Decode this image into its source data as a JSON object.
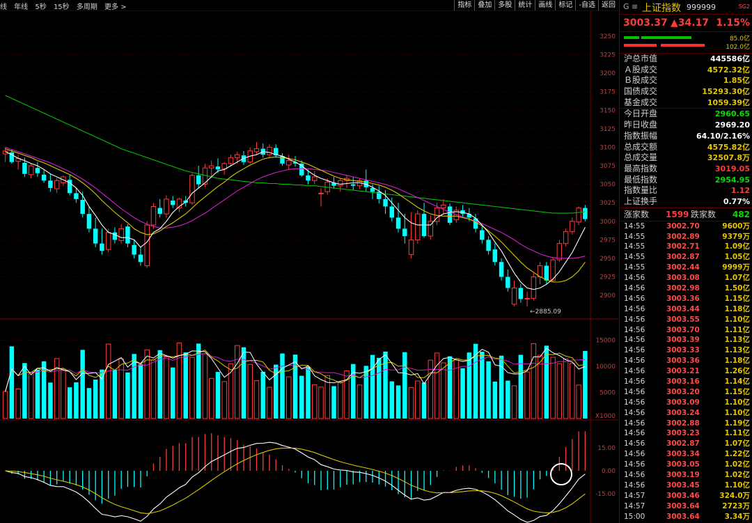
{
  "toolbar": {
    "periods": [
      "线",
      "年线",
      "5秒",
      "15秒",
      "多周期",
      "更多 >"
    ],
    "buttons": [
      "指标",
      "叠加",
      "多股",
      "统计",
      "画线",
      "标记",
      "-自选",
      "返回"
    ]
  },
  "instrument": {
    "g_label": "G ≡",
    "name": "上证指数",
    "code": "999999",
    "tag": "SG2",
    "price": "3003.37",
    "change": "▲34.17",
    "change_pct": "1.15%"
  },
  "flow": {
    "inflow": "85.0亿",
    "outflow": "102.0亿",
    "inflow_color": "#00c000",
    "outflow_color": "#ff3030"
  },
  "stats1": [
    {
      "k": "沪总市值",
      "v": "445586亿",
      "c": "#ffffff"
    },
    {
      "k": "Ａ股成交",
      "v": "4572.32亿",
      "c": "#e6c800"
    },
    {
      "k": "Ｂ股成交",
      "v": "1.85亿",
      "c": "#e6c800"
    },
    {
      "k": "国债成交",
      "v": "15293.30亿",
      "c": "#e6c800"
    },
    {
      "k": "基金成交",
      "v": "1059.39亿",
      "c": "#e6c800"
    }
  ],
  "stats2": [
    {
      "k": "今日开盘",
      "v": "2960.65",
      "c": "#00e000"
    },
    {
      "k": "昨日收盘",
      "v": "2969.20",
      "c": "#ffffff"
    },
    {
      "k": "指数振幅",
      "v": "64.10/2.16%",
      "c": "#ffffff"
    },
    {
      "k": "总成交额",
      "v": "4575.82亿",
      "c": "#e6c800"
    },
    {
      "k": "总成交量",
      "v": "32507.8万",
      "c": "#e6c800"
    },
    {
      "k": "最高指数",
      "v": "3019.05",
      "c": "#ff3b3b"
    },
    {
      "k": "最低指数",
      "v": "2954.95",
      "c": "#00e000"
    },
    {
      "k": "指数量比",
      "v": "1.12",
      "c": "#ff3b3b"
    },
    {
      "k": "上证换手",
      "v": "0.77%",
      "c": "#ffffff"
    }
  ],
  "breadth": {
    "up_label": "涨家数",
    "up": "1599",
    "down_label": "跌家数",
    "down": "482"
  },
  "ticks": [
    [
      "14:55",
      "3002.70",
      "9600万"
    ],
    [
      "14:55",
      "3002.89",
      "9379万"
    ],
    [
      "14:55",
      "3002.71",
      "1.09亿"
    ],
    [
      "14:55",
      "3002.87",
      "1.05亿"
    ],
    [
      "14:55",
      "3002.44",
      "9999万"
    ],
    [
      "14:56",
      "3003.08",
      "1.07亿"
    ],
    [
      "14:56",
      "3002.98",
      "1.50亿"
    ],
    [
      "14:56",
      "3003.36",
      "1.15亿"
    ],
    [
      "14:56",
      "3003.44",
      "1.18亿"
    ],
    [
      "14:56",
      "3003.55",
      "1.10亿"
    ],
    [
      "14:56",
      "3003.70",
      "1.11亿"
    ],
    [
      "14:56",
      "3003.39",
      "1.13亿"
    ],
    [
      "14:56",
      "3003.33",
      "1.13亿"
    ],
    [
      "14:56",
      "3003.36",
      "1.18亿"
    ],
    [
      "14:56",
      "3003.21",
      "1.26亿"
    ],
    [
      "14:56",
      "3003.16",
      "1.14亿"
    ],
    [
      "14:56",
      "3003.20",
      "1.15亿"
    ],
    [
      "14:56",
      "3003.09",
      "1.10亿"
    ],
    [
      "14:56",
      "3003.24",
      "1.10亿"
    ],
    [
      "14:56",
      "3002.88",
      "1.19亿"
    ],
    [
      "14:56",
      "3003.23",
      "1.11亿"
    ],
    [
      "14:56",
      "3002.87",
      "1.07亿"
    ],
    [
      "14:56",
      "3003.34",
      "1.22亿"
    ],
    [
      "14:56",
      "3003.05",
      "1.02亿"
    ],
    [
      "14:56",
      "3003.19",
      "1.02亿"
    ],
    [
      "14:56",
      "3003.45",
      "1.10亿"
    ],
    [
      "14:57",
      "3003.46",
      "324.0万"
    ],
    [
      "14:57",
      "3003.64",
      "2723万"
    ],
    [
      "15:00",
      "3003.64",
      "3.34万"
    ]
  ],
  "chart_data": {
    "type": "candlestick",
    "ylim": [
      2870,
      3265
    ],
    "price_ticks": [
      "3250",
      "3225",
      "3200",
      "3175",
      "3150",
      "3125",
      "3100",
      "3075",
      "3050",
      "3025",
      "3000",
      "2975",
      "2950",
      "2925",
      "2900"
    ],
    "low_label": "2885.09",
    "volume_ticks": [
      "15000",
      "10000",
      "5000"
    ],
    "volume_unit": "X1000",
    "macd_ticks": [
      "15.00",
      "0.00",
      "-15.00"
    ],
    "candles": [
      [
        3091,
        3100,
        3080,
        3095
      ],
      [
        3093,
        3097,
        3078,
        3080
      ],
      [
        3081,
        3090,
        3070,
        3085
      ],
      [
        3079,
        3086,
        3060,
        3064
      ],
      [
        3063,
        3078,
        3058,
        3075
      ],
      [
        3072,
        3080,
        3060,
        3065
      ],
      [
        3063,
        3070,
        3052,
        3055
      ],
      [
        3055,
        3064,
        3040,
        3045
      ],
      [
        3044,
        3058,
        3038,
        3055
      ],
      [
        3052,
        3062,
        3048,
        3060
      ],
      [
        3056,
        3063,
        3035,
        3038
      ],
      [
        3038,
        3045,
        3025,
        3030
      ],
      [
        3029,
        3040,
        3005,
        3010
      ],
      [
        3010,
        3020,
        2985,
        2990
      ],
      [
        2990,
        3005,
        2965,
        2970
      ],
      [
        2970,
        2990,
        2955,
        2960
      ],
      [
        2962,
        2990,
        2958,
        2985
      ],
      [
        2985,
        2992,
        2970,
        2975
      ],
      [
        2974,
        2996,
        2970,
        2990
      ],
      [
        2993,
        2996,
        2965,
        2970
      ],
      [
        2968,
        2975,
        2950,
        2955
      ],
      [
        2955,
        2965,
        2940,
        2945
      ],
      [
        2940,
        3000,
        2937,
        2995
      ],
      [
        2995,
        3025,
        2990,
        3020
      ],
      [
        3018,
        3030,
        3005,
        3010
      ],
      [
        3010,
        3035,
        3005,
        3030
      ],
      [
        3028,
        3034,
        3018,
        3022
      ],
      [
        3018,
        3032,
        3012,
        3030
      ],
      [
        3028,
        3034,
        3020,
        3025
      ],
      [
        3025,
        3065,
        3022,
        3062
      ],
      [
        3062,
        3075,
        3045,
        3050
      ],
      [
        3050,
        3078,
        3046,
        3072
      ],
      [
        3072,
        3082,
        3060,
        3075
      ],
      [
        3074,
        3085,
        3065,
        3070
      ],
      [
        3071,
        3080,
        3063,
        3078
      ],
      [
        3078,
        3090,
        3074,
        3086
      ],
      [
        3086,
        3094,
        3078,
        3090
      ],
      [
        3089,
        3095,
        3076,
        3080
      ],
      [
        3080,
        3100,
        3078,
        3095
      ],
      [
        3094,
        3107,
        3090,
        3098
      ],
      [
        3098,
        3105,
        3086,
        3090
      ],
      [
        3090,
        3104,
        3086,
        3100
      ],
      [
        3099,
        3104,
        3086,
        3089
      ],
      [
        3088,
        3092,
        3075,
        3078
      ],
      [
        3076,
        3090,
        3070,
        3082
      ],
      [
        3080,
        3088,
        3074,
        3078
      ],
      [
        3078,
        3082,
        3060,
        3062
      ],
      [
        3062,
        3070,
        3050,
        3055
      ],
      [
        3055,
        3068,
        3050,
        3060
      ],
      [
        3038,
        3045,
        3020,
        3038
      ],
      [
        3040,
        3058,
        3036,
        3053
      ],
      [
        3052,
        3060,
        3044,
        3048
      ],
      [
        3048,
        3058,
        3040,
        3055
      ],
      [
        3055,
        3062,
        3045,
        3058
      ],
      [
        3050,
        3060,
        3042,
        3048
      ],
      [
        3048,
        3058,
        3044,
        3055
      ],
      [
        3055,
        3070,
        3040,
        3046
      ],
      [
        3045,
        3050,
        3030,
        3040
      ],
      [
        3040,
        3048,
        3024,
        3030
      ],
      [
        3030,
        3042,
        3010,
        3020
      ],
      [
        3020,
        3032,
        3000,
        3005
      ],
      [
        3005,
        3025,
        2985,
        2990
      ],
      [
        2990,
        3010,
        2970,
        2980
      ],
      [
        2955,
        3012,
        2950,
        2975
      ],
      [
        2975,
        3015,
        2970,
        3010
      ],
      [
        3010,
        3025,
        2978,
        2980
      ],
      [
        2980,
        3008,
        2975,
        3000
      ],
      [
        3000,
        3025,
        2995,
        3018
      ],
      [
        3018,
        3030,
        3010,
        3022
      ],
      [
        3020,
        3024,
        2995,
        2998
      ],
      [
        3002,
        3020,
        2998,
        3015
      ],
      [
        3015,
        3022,
        3006,
        3010
      ],
      [
        3010,
        3018,
        3000,
        3005
      ],
      [
        3004,
        3010,
        2985,
        2990
      ],
      [
        2988,
        2995,
        2970,
        2975
      ],
      [
        2975,
        2980,
        2955,
        2960
      ],
      [
        2962,
        2970,
        2940,
        2945
      ],
      [
        2945,
        2950,
        2920,
        2925
      ],
      [
        2925,
        2935,
        2905,
        2910
      ],
      [
        2888,
        2920,
        2885,
        2910
      ],
      [
        2910,
        2915,
        2890,
        2895
      ],
      [
        2895,
        2905,
        2885,
        2896
      ],
      [
        2896,
        2930,
        2893,
        2925
      ],
      [
        2925,
        2945,
        2915,
        2940
      ],
      [
        2940,
        2945,
        2915,
        2920
      ],
      [
        2920,
        2952,
        2918,
        2948
      ],
      [
        2948,
        2975,
        2945,
        2970
      ],
      [
        2970,
        2990,
        2966,
        2986
      ],
      [
        2986,
        3005,
        2982,
        3000
      ],
      [
        2999,
        3020,
        2995,
        3018
      ],
      [
        3018,
        3022,
        3000,
        3003
      ]
    ],
    "ma5": [
      3094,
      3090,
      3085,
      3082,
      3078,
      3075,
      3070,
      3064,
      3060,
      3056,
      3052,
      3045,
      3035,
      3020,
      3008,
      2995,
      2985,
      2982,
      2978,
      2978,
      2975,
      2965,
      2972,
      2985,
      2990,
      3000,
      3012,
      3020,
      3026,
      3038,
      3045,
      3052,
      3060,
      3068,
      3070,
      3075,
      3080,
      3085,
      3088,
      3090,
      3094,
      3093,
      3090,
      3088,
      3084,
      3080,
      3075,
      3068,
      3062,
      3058,
      3055,
      3052,
      3050,
      3051,
      3052,
      3052,
      3050,
      3046,
      3041,
      3035,
      3025,
      3015,
      3005,
      2998,
      2995,
      2995,
      2995,
      3005,
      3010,
      3012,
      3013,
      3012,
      3010,
      3004,
      2995,
      2985,
      2972,
      2960,
      2945,
      2930,
      2918,
      2910,
      2908,
      2910,
      2915,
      2922,
      2932,
      2945,
      2958,
      2975,
      2992
    ],
    "ma10": [
      3098,
      3095,
      3092,
      3089,
      3086,
      3082,
      3079,
      3075,
      3071,
      3067,
      3063,
      3058,
      3052,
      3045,
      3037,
      3028,
      3020,
      3012,
      3005,
      2998,
      2990,
      2985,
      2982,
      2983,
      2987,
      2993,
      2998,
      3004,
      3010,
      3018,
      3026,
      3033,
      3040,
      3047,
      3053,
      3060,
      3066,
      3071,
      3076,
      3080,
      3084,
      3086,
      3087,
      3086,
      3085,
      3083,
      3080,
      3077,
      3073,
      3069,
      3065,
      3061,
      3058,
      3056,
      3055,
      3054,
      3053,
      3051,
      3049,
      3046,
      3042,
      3037,
      3031,
      3025,
      3019,
      3014,
      3010,
      3008,
      3007,
      3007,
      3007,
      3005,
      3003,
      2999,
      2994,
      2987,
      2980,
      2972,
      2963,
      2954,
      2945,
      2937,
      2931,
      2925,
      2921,
      2918,
      2918,
      2920,
      2925,
      2933,
      2945
    ],
    "ma20": [
      3100,
      3097,
      3094,
      3091,
      3088,
      3085,
      3082,
      3079,
      3075,
      3071,
      3067,
      3062,
      3057,
      3051,
      3045,
      3038,
      3031,
      3024,
      3017,
      3011,
      3005,
      3000,
      2996,
      2993,
      2991,
      2991,
      2992,
      2994,
      2997,
      3001,
      3006,
      3011,
      3017,
      3023,
      3029,
      3035,
      3041,
      3046,
      3051,
      3056,
      3060,
      3063,
      3066,
      3068,
      3070,
      3071,
      3071,
      3071,
      3070,
      3069,
      3068,
      3066,
      3064,
      3062,
      3060,
      3058,
      3056,
      3054,
      3052,
      3050,
      3047,
      3044,
      3040,
      3036,
      3032,
      3028,
      3024,
      3020,
      3016,
      3012,
      3009,
      3006,
      3003,
      3000,
      2997,
      2993,
      2989,
      2985,
      2980,
      2975,
      2969,
      2964,
      2960,
      2956,
      2953,
      2951,
      2950,
      2950,
      2950,
      2951,
      2953
    ],
    "ma60": [
      3170,
      3166,
      3162,
      3158,
      3154,
      3150,
      3146,
      3142,
      3138,
      3134,
      3130,
      3126,
      3122,
      3118,
      3114,
      3110,
      3106,
      3102,
      3098,
      3095,
      3092,
      3089,
      3086,
      3083,
      3080,
      3077,
      3074,
      3071,
      3068,
      3066,
      3064,
      3062,
      3060,
      3058,
      3057,
      3056,
      3055,
      3054,
      3053,
      3052,
      3052,
      3051,
      3051,
      3050,
      3050,
      3049,
      3049,
      3048,
      3048,
      3047,
      3046,
      3045,
      3044,
      3043,
      3042,
      3041,
      3040,
      3039,
      3038,
      3037,
      3036,
      3035,
      3034,
      3033,
      3032,
      3031,
      3030,
      3029,
      3028,
      3027,
      3026,
      3025,
      3024,
      3023,
      3022,
      3021,
      3020,
      3019,
      3018,
      3017,
      3016,
      3015,
      3014,
      3013,
      3012,
      3011,
      3011,
      3011,
      3011,
      3012,
      3013
    ]
  }
}
